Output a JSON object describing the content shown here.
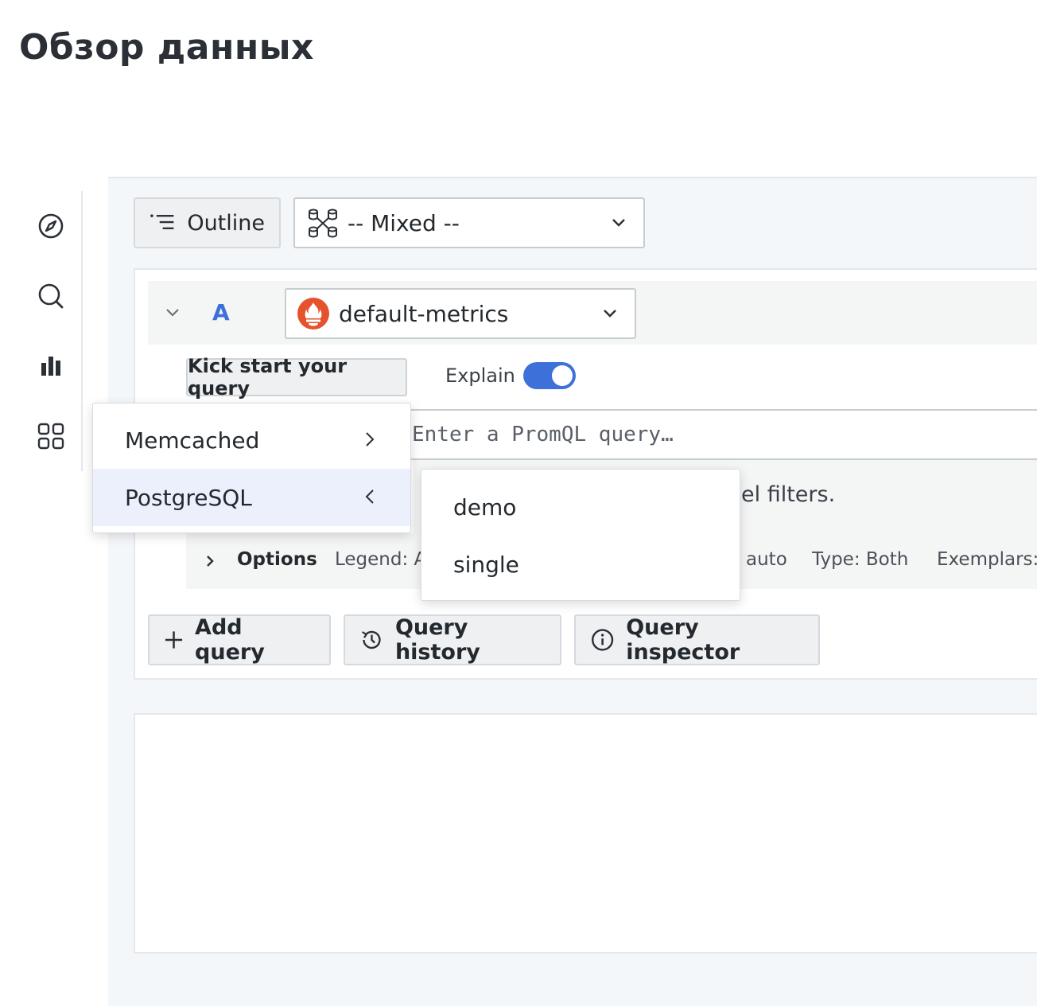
{
  "page": {
    "title": "Обзор данных"
  },
  "sidebar": {
    "items": [
      {
        "icon": "compass-icon"
      },
      {
        "icon": "search-icon"
      },
      {
        "icon": "bar-chart-icon"
      },
      {
        "icon": "grid-icon"
      }
    ]
  },
  "toolbar": {
    "outline_label": "Outline",
    "datasource_label": "-- Mixed --"
  },
  "query": {
    "ref_id": "A",
    "datasource": "default-metrics",
    "kick_start_label": "Kick start your query",
    "explain_label": "Explain",
    "explain_on": true,
    "placeholder": "Enter a PromQL query…",
    "hint_fragment": "el filters.",
    "options": {
      "label": "Options",
      "legend": "Legend: A",
      "step": "auto",
      "type": "Type: Both",
      "exemplars": "Exemplars:"
    }
  },
  "actions": {
    "add_query": "Add query",
    "query_history": "Query history",
    "query_inspector": "Query inspector"
  },
  "datasource_menu": {
    "items": [
      {
        "label": "Memcached",
        "chevron": "right"
      },
      {
        "label": "PostgreSQL",
        "chevron": "left"
      }
    ]
  },
  "submenu": {
    "items": [
      "demo",
      "single"
    ]
  },
  "colors": {
    "accent": "#3d71d9",
    "ref_id": "#3d71d9",
    "prometheus": "#e6522c"
  }
}
